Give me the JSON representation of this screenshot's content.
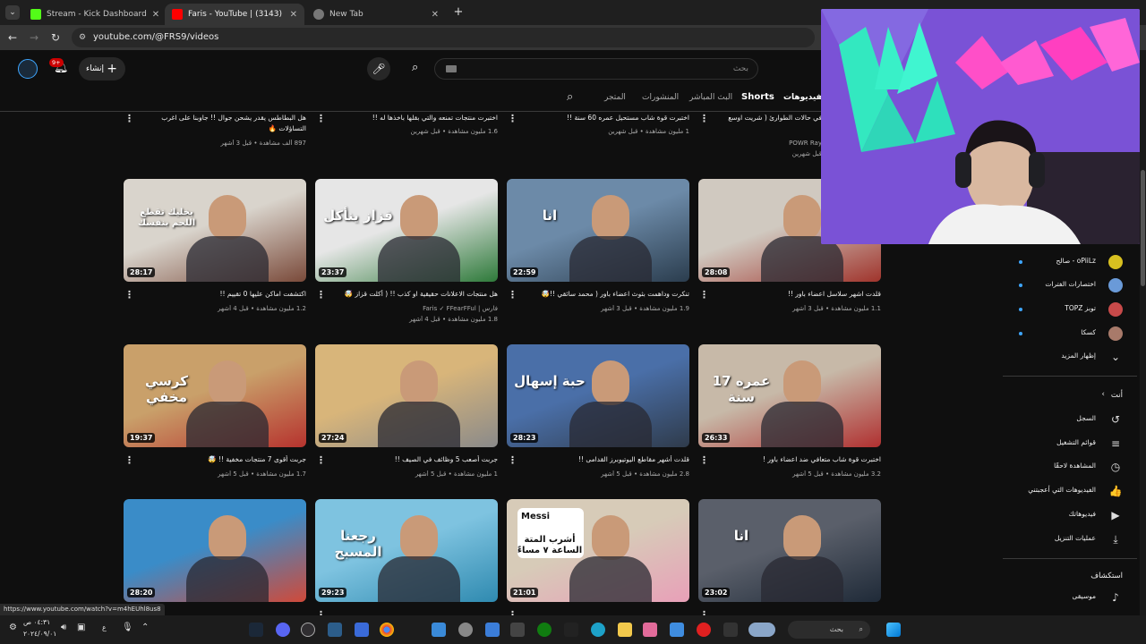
{
  "browser": {
    "tabs": [
      {
        "title": "Stream - Kick Dashboard",
        "favicon_color": "#53fc18"
      },
      {
        "title": "Faris - YouTube | فارس (3143)",
        "favicon_color": "#ff0000"
      },
      {
        "title": "New Tab",
        "favicon_color": "#888888"
      }
    ],
    "url": "youtube.com/@FRS9/videos"
  },
  "youtube": {
    "search_placeholder": "بحث",
    "create_label": "إنشاء",
    "notification_badge": "9+",
    "channel_tabs": [
      "الفيديوهات",
      "Shorts",
      "البث المباشر",
      "المنشورات",
      "المتجر"
    ]
  },
  "top_row": [
    {
      "title": "هل البطاطس يقدر يشحن جوال !! جاوبنا على اغرب",
      "title2": "التساؤلات 🔥",
      "meta": "897 ألف مشاهدة • قبل 3 أشهر"
    },
    {
      "title": "اختبرت منتجات تمنعه والتي بقلها باخذها له !!",
      "title2": "",
      "meta": "1.6 مليون مشاهدة • قبل شهرين"
    },
    {
      "title": "اختبرت قوة شاب مستحيل عمره 60 سنة !!",
      "title2": "",
      "meta": "1 مليون مشاهدة • قبل شهرين"
    },
    {
      "title": "في حالات الطوارئ ( شريت اوسع",
      "title2": "POWR Ray",
      "meta": "قبل شهرين"
    }
  ],
  "videos": [
    {
      "duration": "28:17",
      "title": "اكتشفت اماكن عليها 0 تقييم !!",
      "channel": "",
      "meta": "1.2 مليون مشاهدة • قبل 4 أشهر",
      "thumb_text": "يخليك تقطع اللحم بنفسك",
      "colors": [
        "#d9d4cc",
        "#7a4a3a"
      ]
    },
    {
      "duration": "23:37",
      "title": "هل منتجات الاعلانات حقيقية او كذب !! ( أكلت قزاز 🤯",
      "channel": "فارس | Faris ✓ FFearFFul",
      "meta": "1.8 مليون مشاهدة • قبل 4 أشهر",
      "thumb_text": "قزاز ينأكل",
      "colors": [
        "#e6e6e6",
        "#2e7a3a"
      ]
    },
    {
      "duration": "22:59",
      "title": "تنكرت وداهمت بثوث اعضاء باور ( محمد سائقي !!🤯",
      "channel": "",
      "meta": "1.9 مليون مشاهدة • قبل 3 أشهر",
      "thumb_text": "انا",
      "colors": [
        "#6c8aa8",
        "#2b3d4e"
      ]
    },
    {
      "duration": "28:08",
      "title": "قلدت اشهر سلاسل اعضاء باور !!",
      "channel": "",
      "meta": "1.1 مليون مشاهدة • قبل 3 أشهر",
      "thumb_text": "",
      "colors": [
        "#d0c9c0",
        "#a0342c"
      ]
    },
    {
      "duration": "19:37",
      "title": "جربت أقوى 7 منتجات مخفية !! 🤯",
      "channel": "",
      "meta": "1.7 مليون مشاهدة • قبل 5 أشهر",
      "thumb_text": "كرسي مخفي",
      "colors": [
        "#c9a06a",
        "#b6332e"
      ]
    },
    {
      "duration": "27:24",
      "title": "جربت أصعب 5 وظائف في الصيف !!",
      "channel": "",
      "meta": "1 مليون مشاهدة • قبل 5 أشهر",
      "thumb_text": "",
      "colors": [
        "#d8b57a",
        "#8a8a8a"
      ]
    },
    {
      "duration": "28:23",
      "title": "قلدت أشهر مقاطع اليوتيوبرز القدامى !!",
      "channel": "",
      "meta": "2.8 مليون مشاهدة • قبل 5 أشهر",
      "thumb_text": "حبة إسهال",
      "colors": [
        "#4a6fa8",
        "#2f3b4b"
      ]
    },
    {
      "duration": "26:33",
      "title": "اختبرت قوة شاب متعافي ضد اعضاء باور !",
      "channel": "",
      "meta": "3.2 مليون مشاهدة • قبل 5 أشهر",
      "thumb_text": "عمره 17 سنة",
      "colors": [
        "#c7b9a8",
        "#b03030"
      ]
    },
    {
      "duration": "28:20",
      "title": "",
      "channel": "",
      "meta": "",
      "thumb_text": "",
      "colors": [
        "#3a8cc8",
        "#d04a3a"
      ]
    },
    {
      "duration": "29:23",
      "title": "",
      "channel": "",
      "meta": "",
      "thumb_text": "رجعنا المسبح",
      "colors": [
        "#7ec3e0",
        "#2f8ab0"
      ]
    },
    {
      "duration": "21:01",
      "title": "",
      "channel": "",
      "meta": "",
      "thumb_text": "أشرب المتة الساعة ٧ مساءً",
      "colors": [
        "#d7cbb8",
        "#e8a0b8"
      ],
      "card_name": "Messi"
    },
    {
      "duration": "23:02",
      "title": "",
      "channel": "",
      "meta": "",
      "thumb_text": "انا",
      "colors": [
        "#5a5f6a",
        "#1f2a38"
      ]
    }
  ],
  "sidebar": {
    "subs": [
      {
        "label": "oPiiLz - صالح",
        "color": "#d8c020"
      },
      {
        "label": "اختصارات الفترات",
        "color": "#6a9ad8"
      },
      {
        "label": "توبز TOPZ",
        "color": "#c84a4a"
      },
      {
        "label": "كسكا",
        "color": "#a87a6a"
      }
    ],
    "show_more": "إظهار المزيد",
    "you_header": "أنت",
    "you_items": [
      {
        "label": "السجل",
        "icon": "↺"
      },
      {
        "label": "قوائم التشغيل",
        "icon": "≡"
      },
      {
        "label": "المشاهدة لاحقًا",
        "icon": "◷"
      },
      {
        "label": "الفيديوهات التي أعجبتني",
        "icon": "👍"
      },
      {
        "label": "فيديوهاتك",
        "icon": "▶"
      },
      {
        "label": "عمليات التنزيل",
        "icon": "⤓"
      }
    ],
    "explore_header": "استكشاف",
    "music_label": "موسيقى"
  },
  "status_url": "https://www.youtube.com/watch?v=m4hEUhl8us8",
  "taskbar": {
    "search_label": "بحث",
    "time": "٠٤:٣١ ص",
    "date": "٢٠٢٤/٠٩/٠١"
  }
}
